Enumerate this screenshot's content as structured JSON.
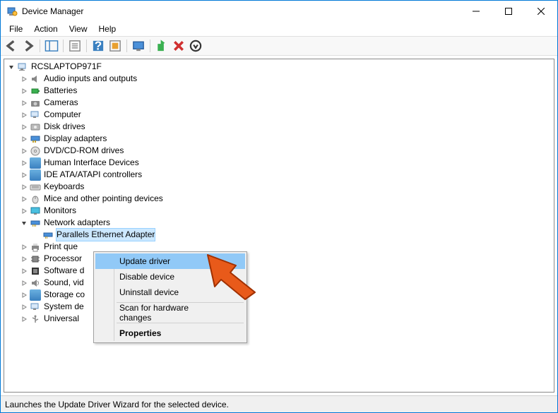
{
  "window": {
    "title": "Device Manager"
  },
  "menu": {
    "file": "File",
    "action": "Action",
    "view": "View",
    "help": "Help"
  },
  "tree": {
    "root": "RCSLAPTOP971F",
    "nodes": [
      {
        "label": "Audio inputs and outputs"
      },
      {
        "label": "Batteries"
      },
      {
        "label": "Cameras"
      },
      {
        "label": "Computer"
      },
      {
        "label": "Disk drives"
      },
      {
        "label": "Display adapters"
      },
      {
        "label": "DVD/CD-ROM drives"
      },
      {
        "label": "Human Interface Devices"
      },
      {
        "label": "IDE ATA/ATAPI controllers"
      },
      {
        "label": "Keyboards"
      },
      {
        "label": "Mice and other pointing devices"
      },
      {
        "label": "Monitors"
      },
      {
        "label": "Network adapters",
        "expanded": true
      },
      {
        "label": "Print queues"
      },
      {
        "label": "Processors"
      },
      {
        "label": "Software devices"
      },
      {
        "label": "Sound, video and game controllers"
      },
      {
        "label": "Storage controllers"
      },
      {
        "label": "System devices"
      },
      {
        "label": "Universal Serial Bus controllers"
      }
    ],
    "network_child": "Parallels Ethernet Adapter"
  },
  "truncated": {
    "print": "Print que",
    "proc": "Processor",
    "soft": "Software d",
    "sound": "Sound, vid",
    "storage": "Storage co",
    "system": "System de",
    "usb": "Universal "
  },
  "context_menu": {
    "update": "Update driver",
    "disable": "Disable device",
    "uninstall": "Uninstall device",
    "scan": "Scan for hardware changes",
    "properties": "Properties"
  },
  "status": "Launches the Update Driver Wizard for the selected device."
}
